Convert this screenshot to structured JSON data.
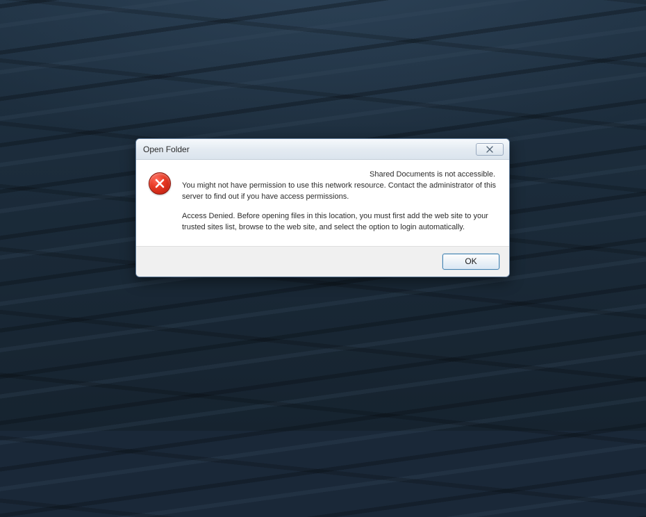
{
  "dialog": {
    "title": "Open Folder",
    "headline": "Shared Documents is not accessible.",
    "paragraph1": "You might not have permission to use this network resource. Contact the administrator of this server to find out if you have access permissions.",
    "paragraph2": "Access Denied. Before opening files in this location, you must first add the web site to your trusted sites list, browse to the web site, and select the option to login automatically.",
    "ok_label": "OK"
  }
}
